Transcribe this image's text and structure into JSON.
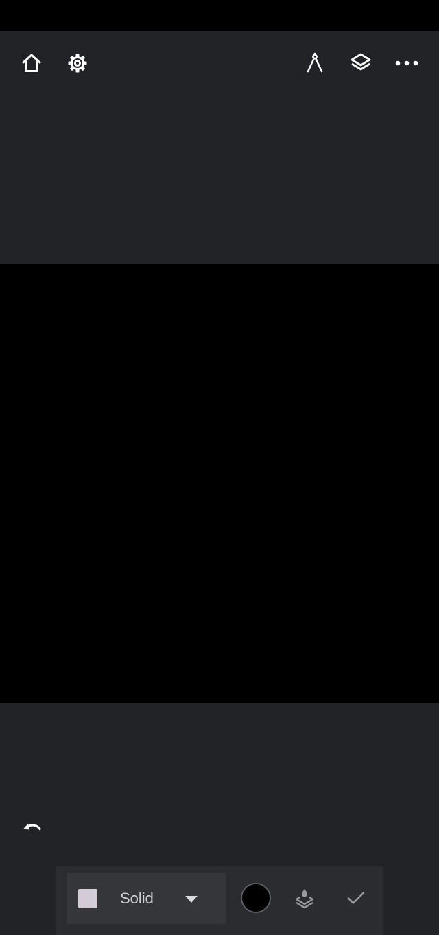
{
  "top_toolbar": {
    "home_icon": "home-icon",
    "settings_icon": "gear-icon",
    "compass_icon": "compass-icon",
    "layers_icon": "layers-icon",
    "more_icon": "more-horizontal-icon"
  },
  "undo_icon": "undo-icon",
  "fill_toolbar": {
    "swatch_color": "#d4cbd9",
    "fill_type_label": "Solid",
    "selected_color": "#000000",
    "layer_fill_icon": "layer-fill-icon",
    "confirm_icon": "check-icon"
  },
  "colors": {
    "workspace": "#222326",
    "canvas": "#000000",
    "icon": "#ffffff"
  }
}
